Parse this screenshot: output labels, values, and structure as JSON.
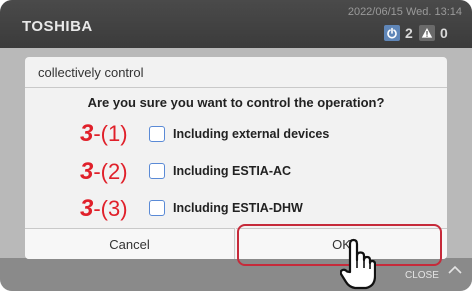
{
  "header": {
    "brand": "TOSHIBA",
    "datetime": "2022/06/15 Wed. 13:14",
    "power_count": "2",
    "alarm_count": "0"
  },
  "dialog": {
    "title": "collectively control",
    "question": "Are you sure you want to control the operation?",
    "options": [
      {
        "callout_num": "3",
        "callout_paren": "-(1)",
        "label": "Including external devices"
      },
      {
        "callout_num": "3",
        "callout_paren": "-(2)",
        "label": "Including ESTIA-AC"
      },
      {
        "callout_num": "3",
        "callout_paren": "-(3)",
        "label": "Including ESTIA-DHW"
      }
    ],
    "cancel_label": "Cancel",
    "ok_label": "OK"
  },
  "footer": {
    "close_label": "CLOSE"
  },
  "colors": {
    "accent_blue": "#5a8ad6",
    "callout_red": "#e0202a",
    "highlight_red": "#c62a3a"
  },
  "icons": [
    "power-icon",
    "alert-icon",
    "chevron-up-icon",
    "pointing-hand-icon"
  ]
}
